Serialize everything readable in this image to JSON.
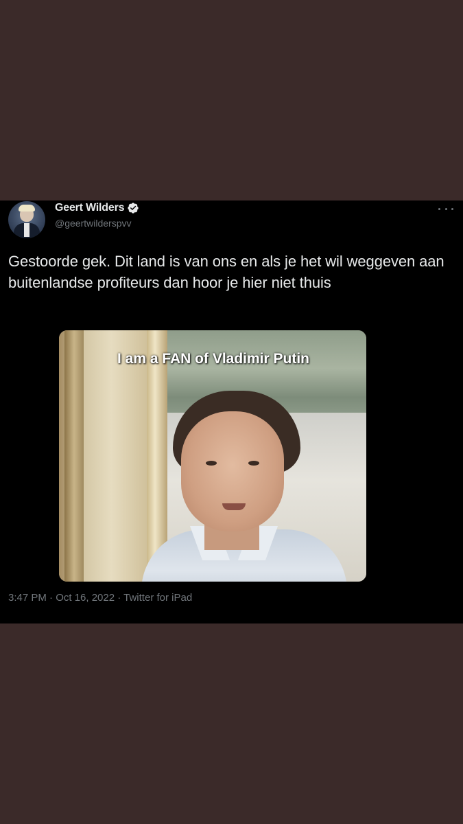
{
  "tweet": {
    "display_name": "Geert Wilders",
    "handle": "@geertwilderspvv",
    "text": "Gestoorde gek. Dit land is van ons en als je het wil weggeven aan buitenlandse profiteurs dan hoor je hier niet thuis",
    "media_caption": "I am a FAN of Vladimir Putin",
    "timestamp": "3:47 PM · Oct 16, 2022 · Twitter for iPad"
  },
  "icons": {
    "verified": "verified-badge-icon",
    "more": "more-options-icon"
  },
  "colors": {
    "page_background": "#3b2a29",
    "card_background": "#000000",
    "primary_text": "#e7e9ea",
    "secondary_text": "#71767b"
  }
}
